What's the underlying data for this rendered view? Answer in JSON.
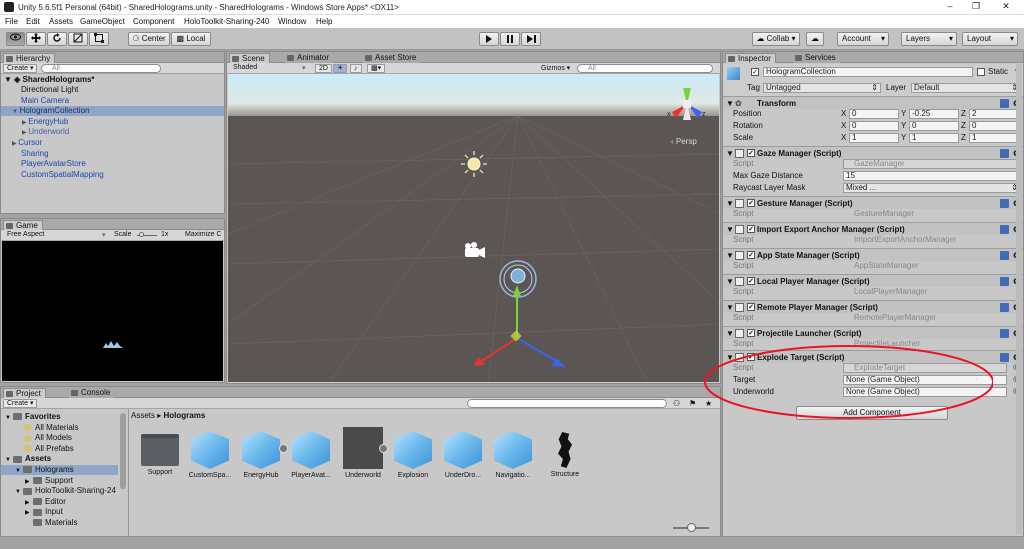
{
  "window": {
    "title": "Unity 5.6.5f1 Personal (64bit) - SharedHolograms.unity - SharedHolograms - Windows Store Apps* <DX11>",
    "controls": [
      "–",
      "❐",
      "✕"
    ]
  },
  "menu": [
    "File",
    "Edit",
    "Assets",
    "GameObject",
    "Component",
    "HoloToolkit-Sharing-240",
    "Window",
    "Help"
  ],
  "toolbar": {
    "pivot": "Center",
    "space": "Local",
    "collab": "Collab ▾",
    "account": "Account",
    "layers": "Layers",
    "layout": "Layout"
  },
  "hierarchy": {
    "tab": "Hierarchy",
    "create": "Create ▾",
    "search_placeholder": "All",
    "scene": "SharedHolograms*",
    "items": [
      {
        "label": "Directional Light",
        "indent": 1,
        "style": "normal"
      },
      {
        "label": "Main Camera",
        "indent": 1,
        "style": "blue"
      },
      {
        "label": "HologramCollection",
        "indent": 1,
        "style": "selected",
        "arrow": "▼"
      },
      {
        "label": "EnergyHub",
        "indent": 2,
        "style": "blue",
        "arrow": "▶"
      },
      {
        "label": "Underworld",
        "indent": 2,
        "style": "prefab",
        "arrow": "▶"
      },
      {
        "label": "Cursor",
        "indent": 1,
        "style": "blue",
        "arrow": "▶"
      },
      {
        "label": "Sharing",
        "indent": 1,
        "style": "blue"
      },
      {
        "label": "PlayerAvatarStore",
        "indent": 1,
        "style": "blue"
      },
      {
        "label": "CustomSpatialMapping",
        "indent": 1,
        "style": "blue"
      }
    ]
  },
  "game": {
    "tab": "Game",
    "aspect": "Free Aspect",
    "scale_label": "Scale",
    "scale_value": "1x",
    "maximize": "Maximize C"
  },
  "scene": {
    "tabs": [
      "Scene",
      "Animator",
      "Asset Store"
    ],
    "shading": "Shaded",
    "mode_2d": "2D",
    "gizmos": "Gizmos ▾",
    "search_placeholder": "All",
    "persp": "‹ Persp",
    "axis": {
      "x": "x",
      "z": "z"
    }
  },
  "inspector": {
    "tabs": [
      "Inspector",
      "Services"
    ],
    "object_name": "HologramCollection",
    "static_label": "Static",
    "tag_label": "Tag",
    "tag_value": "Untagged",
    "layer_label": "Layer",
    "layer_value": "Default",
    "transform": {
      "title": "Transform",
      "rows": [
        {
          "label": "Position",
          "x": "0",
          "y": "-0.25",
          "z": "2"
        },
        {
          "label": "Rotation",
          "x": "0",
          "y": "0",
          "z": "0"
        },
        {
          "label": "Scale",
          "x": "1",
          "y": "1",
          "z": "1"
        }
      ],
      "axis_labels": [
        "X",
        "Y",
        "Z"
      ]
    },
    "gaze": {
      "title": "Gaze Manager (Script)",
      "script_label": "Script",
      "script_value": "GazeManager",
      "dist_label": "Max Gaze Distance",
      "dist_value": "15",
      "mask_label": "Raycast Layer Mask",
      "mask_value": "Mixed ..."
    },
    "components": [
      {
        "title": "Gesture Manager (Script)",
        "script": "GestureManager"
      },
      {
        "title": "Import Export Anchor Manager (Script)",
        "script": "ImportExportAnchorManager"
      },
      {
        "title": "App State Manager (Script)",
        "script": "AppStateManager"
      },
      {
        "title": "Local Player Manager (Script)",
        "script": "LocalPlayerManager"
      },
      {
        "title": "Remote Player Manager (Script)",
        "script": "RemotePlayerManager"
      },
      {
        "title": "Projectile Launcher (Script)",
        "script": "ProjectileLauncher"
      }
    ],
    "script_label": "Script",
    "explode": {
      "title": "Explode Target (Script)",
      "script_label": "Script",
      "script_value": "ExplodeTarget",
      "target_label": "Target",
      "target_value": "None (Game Object)",
      "underworld_label": "Underworld",
      "underworld_value": "None (Game Object)"
    },
    "add_component": "Add Component"
  },
  "project": {
    "tabs": [
      "Project",
      "Console"
    ],
    "create": "Create ▾",
    "breadcrumb_root": "Assets",
    "breadcrumb_sep": "▸",
    "breadcrumb_current": "Holograms",
    "tree": [
      {
        "label": "Favorites",
        "indent": 0,
        "bold": true,
        "arrow": "▼"
      },
      {
        "label": "All Materials",
        "indent": 1
      },
      {
        "label": "All Models",
        "indent": 1
      },
      {
        "label": "All Prefabs",
        "indent": 1
      },
      {
        "label": "Assets",
        "indent": 0,
        "bold": true,
        "arrow": "▼"
      },
      {
        "label": "Holograms",
        "indent": 1,
        "selected": true,
        "arrow": "▼"
      },
      {
        "label": "Support",
        "indent": 2,
        "arrow": "▶"
      },
      {
        "label": "HoloToolkit-Sharing-24",
        "indent": 1,
        "arrow": "▼"
      },
      {
        "label": "Editor",
        "indent": 2,
        "arrow": "▶"
      },
      {
        "label": "Input",
        "indent": 2,
        "arrow": "▶"
      },
      {
        "label": "Materials",
        "indent": 2
      }
    ],
    "assets": [
      {
        "name": "Support",
        "kind": "folder"
      },
      {
        "name": "CustomSpa...",
        "kind": "cube"
      },
      {
        "name": "EnergyHub",
        "kind": "cube"
      },
      {
        "name": "PlayerAvat...",
        "kind": "cube"
      },
      {
        "name": "Underworld",
        "kind": "dark"
      },
      {
        "name": "Explosion",
        "kind": "cube"
      },
      {
        "name": "UnderDro...",
        "kind": "cube"
      },
      {
        "name": "Navigatio...",
        "kind": "cube"
      },
      {
        "name": "Structure",
        "kind": "structure"
      }
    ]
  },
  "colors": {
    "selection": "#8fa6c8",
    "annotation": "#e8142a",
    "prefab_blue": "#1c48ad"
  }
}
